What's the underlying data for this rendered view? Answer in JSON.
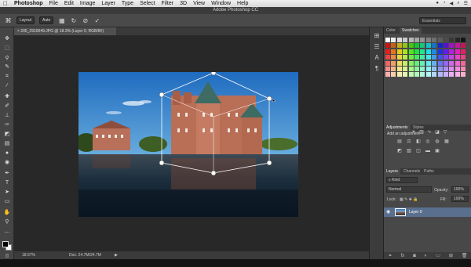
{
  "menubar": {
    "apple": "",
    "app_name": "Photoshop",
    "items": [
      "File",
      "Edit",
      "Image",
      "Layer",
      "Type",
      "Select",
      "Filter",
      "3D",
      "View",
      "Window",
      "Help"
    ]
  },
  "window": {
    "title": "Adobe Photoshop CC"
  },
  "options": {
    "chip1": "Layout",
    "chip2": "Auto",
    "workspace": "Essentials"
  },
  "document": {
    "tab_label": "205_2910049.JPG @ 18.3% (Layer 0, RGB/8#)"
  },
  "status": {
    "zoom": "18.67%",
    "doc": "Doc: 24.7M/24.7M"
  },
  "panels": {
    "color_tab": "Color",
    "swatches_tab": "Swatches",
    "adjustments_tab": "Adjustments",
    "styles_tab": "Styles",
    "add_adjustment": "Add an adjustment",
    "layers_tab": "Layers",
    "channels_tab": "Channels",
    "paths_tab": "Paths",
    "kind": "Kind",
    "blend_mode": "Normal",
    "opacity_label": "Opacity:",
    "opacity_value": "100%",
    "lock_label": "Lock:",
    "fill_label": "Fill:",
    "fill_value": "100%",
    "layer_name": "Layer 0"
  },
  "icons": {
    "move": "move-icon",
    "marquee": "marquee-icon",
    "lasso": "lasso-icon",
    "crop": "crop-icon",
    "eyedropper": "eyedropper-icon",
    "brush": "brush-icon",
    "stamp": "stamp-icon",
    "eraser": "eraser-icon",
    "gradient": "gradient-icon",
    "dodge": "dodge-icon",
    "pen": "pen-icon",
    "type": "type-icon",
    "path": "path-select-icon",
    "shape": "shape-icon",
    "hand": "hand-icon",
    "zoom": "zoom-icon"
  },
  "colors": {
    "sky": "#2f7fd0",
    "water": "#0f2234",
    "brick": "#b8705a",
    "roof": "#3e6b62",
    "selected_layer": "#5a6f8e"
  }
}
